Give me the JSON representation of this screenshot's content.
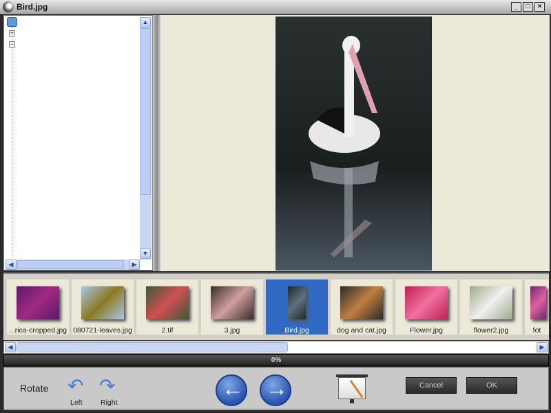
{
  "window": {
    "title": "Bird.jpg",
    "minimize": "_",
    "maximize": "□",
    "close": "×",
    "app_icon": "disc-icon"
  },
  "tree": {
    "expand": "+",
    "collapse": "−",
    "root_icon": "refresh-folder-icon",
    "up": "▲",
    "down": "▼",
    "left": "◀",
    "right": "▶"
  },
  "preview": {
    "image": "pelican-photo"
  },
  "thumbnails": [
    {
      "label": "...rica-cropped.jpg",
      "colors": [
        "#5a1a6e",
        "#a02a80"
      ]
    },
    {
      "label": "080721-leaves.jpg",
      "colors": [
        "#a8c8e8",
        "#8a7a20"
      ]
    },
    {
      "label": "2.tif",
      "colors": [
        "#3a5a3a",
        "#d05050"
      ]
    },
    {
      "label": "3.jpg",
      "colors": [
        "#3a2a2a",
        "#d0a0a0"
      ]
    },
    {
      "label": "Bird.jpg",
      "colors": [
        "#1a2a2a",
        "#607080"
      ],
      "selected": true
    },
    {
      "label": "dog and cat.jpg",
      "colors": [
        "#2a2a2a",
        "#c08040"
      ]
    },
    {
      "label": "Flower.jpg",
      "colors": [
        "#c02050",
        "#f070a0"
      ]
    },
    {
      "label": "flower2.jpg",
      "colors": [
        "#a0a890",
        "#f0f0f0"
      ]
    },
    {
      "label": "fot",
      "colors": [
        "#6a2a6a",
        "#e060a0"
      ]
    }
  ],
  "progress": {
    "text": "0%",
    "value": 0
  },
  "toolbar": {
    "rotate_label": "Rotate",
    "left_label": "Left",
    "right_label": "Right",
    "cancel": "Cancel",
    "ok": "OK",
    "slideshow_icon": "slideshow-icon"
  }
}
